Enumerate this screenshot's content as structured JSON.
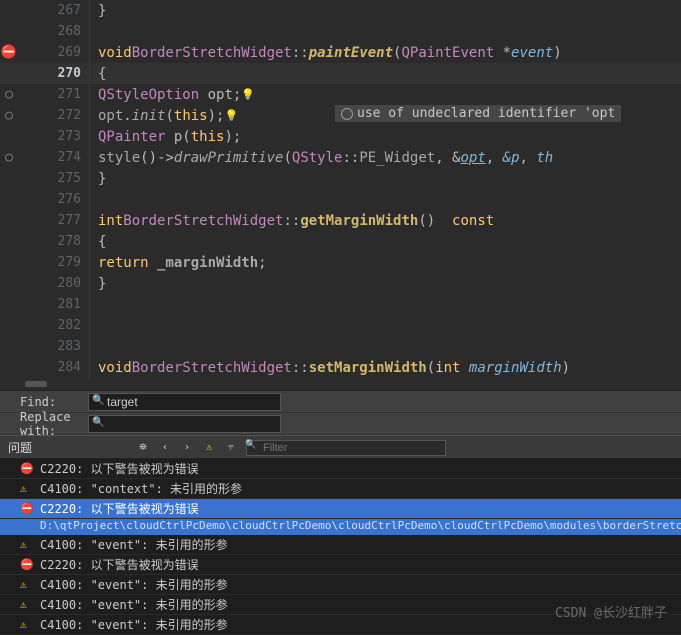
{
  "gutter": {
    "lines": [
      267,
      268,
      269,
      270,
      271,
      272,
      273,
      274,
      275,
      276,
      277,
      278,
      279,
      280,
      281,
      282,
      283,
      284
    ],
    "current": 270,
    "markers": {
      "269": "error",
      "271": "bp",
      "272": "bp",
      "274": "bp"
    }
  },
  "code": {
    "l267": "}",
    "l269_kw": "void",
    "l269_cls": "BorderStretchWidget",
    "l269_sc": "::",
    "l269_fn": "paintEvent",
    "l269_p1": "(",
    "l269_pt": "QPaintEvent",
    "l269_star": " *",
    "l269_arg": "event",
    "l269_p2": ")",
    "l270": "{",
    "l271_t": "QStyleOption",
    "l271_v": " opt;",
    "l272_a": "opt",
    "l272_b": ".",
    "l272_c": "init",
    "l272_d": "(",
    "l272_e": "this",
    "l272_f": ");",
    "l273_a": "QPainter",
    "l273_b": " p(",
    "l273_c": "this",
    "l273_d": ");",
    "l274_a": "style",
    "l274_b": "()->",
    "l274_c": "drawPrimitive",
    "l274_d": "(",
    "l274_e": "QStyle",
    "l274_f": "::",
    "l274_g": "PE_Widget",
    "l274_h": ", &",
    "l274_i": "opt",
    "l274_j": ", ",
    "l274_k": "&p",
    "l274_l": ", ",
    "l274_m": "th",
    "l275": "}",
    "l277_kw": "int",
    "l277_cls": "BorderStretchWidget",
    "l277_sc": "::",
    "l277_fn": "getMarginWidth",
    "l277_p": "()",
    "l277_cv": "  const",
    "l278": "{",
    "l279_kw": "return",
    "l279_v": " _marginWidth",
    "l279_s": ";",
    "l280": "}",
    "l284_kw": "void",
    "l284_cls": "BorderStretchWidget",
    "l284_sc": "::",
    "l284_fn": "setMarginWidth",
    "l284_p1": "(",
    "l284_pt": "int",
    "l284_arg": " marginWidth",
    "l284_p2": ")"
  },
  "inline_error": "use of undeclared identifier 'opt",
  "find": {
    "find_label": "Find:",
    "replace_label": "Replace with:",
    "find_value": "target",
    "replace_value": ""
  },
  "problems": {
    "title": "问题",
    "filter_placeholder": "Filter",
    "items": [
      {
        "type": "err",
        "text": "C2220: 以下警告被视为错误"
      },
      {
        "type": "warn",
        "text": "C4100: \"context\": 未引用的形参"
      },
      {
        "type": "err",
        "text": "C2220: 以下警告被视为错误",
        "selected": true,
        "path": "D:\\qtProject\\cloudCtrlPcDemo\\cloudCtrlPcDemo\\cloudCtrlPcDemo\\cloudCtrlPcDemo\\modules\\borderStretchWidget\\BorderStret"
      },
      {
        "type": "warn",
        "text": "C4100: \"event\": 未引用的形参"
      },
      {
        "type": "err",
        "text": "C2220: 以下警告被视为错误"
      },
      {
        "type": "warn",
        "text": "C4100: \"event\": 未引用的形参"
      },
      {
        "type": "warn",
        "text": "C4100: \"event\": 未引用的形参"
      },
      {
        "type": "warn",
        "text": "C4100: \"event\": 未引用的形参"
      }
    ]
  },
  "watermark": "CSDN @长沙红胖子"
}
